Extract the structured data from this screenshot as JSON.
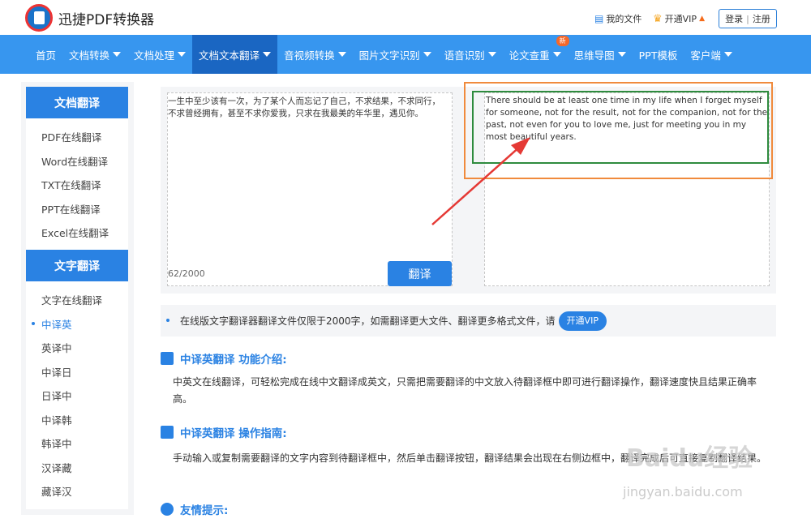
{
  "header": {
    "brand": "迅捷PDF转换器",
    "my_files": "我的文件",
    "vip": "开通VIP",
    "login": "登录",
    "separator": "|",
    "register": "注册"
  },
  "nav": {
    "items": [
      {
        "label": "首页",
        "dropdown": false
      },
      {
        "label": "文档转换",
        "dropdown": true
      },
      {
        "label": "文档处理",
        "dropdown": true
      },
      {
        "label": "文档文本翻译",
        "dropdown": true,
        "active": true
      },
      {
        "label": "音视频转换",
        "dropdown": true
      },
      {
        "label": "图片文字识别",
        "dropdown": true
      },
      {
        "label": "语音识别",
        "dropdown": true
      },
      {
        "label": "论文查重",
        "dropdown": true,
        "badge": "新"
      },
      {
        "label": "思维导图",
        "dropdown": true
      },
      {
        "label": "PPT模板",
        "dropdown": false
      },
      {
        "label": "客户端",
        "dropdown": true
      }
    ]
  },
  "sidebar": {
    "group1_title": "文档翻译",
    "group1_items": [
      "PDF在线翻译",
      "Word在线翻译",
      "TXT在线翻译",
      "PPT在线翻译",
      "Excel在线翻译"
    ],
    "group2_title": "文字翻译",
    "group2_items": [
      "文字在线翻译",
      "中译英",
      "英译中",
      "中译日",
      "日译中",
      "中译韩",
      "韩译中",
      "汉译藏",
      "藏译汉"
    ],
    "active_item": "中译英"
  },
  "translator": {
    "input_text": "一生中至少该有一次，为了某个人而忘记了自己，不求结果，不求同行，不求曾经拥有，甚至不求你爱我，只求在我最美的年华里，遇见你。",
    "counter": "62/2000",
    "translate_button": "翻译",
    "output_text": "There should be at least one time in my life when I forget myself for someone, not for the result, not for the companion, not for the past, not even for you to love me, just for meeting you in my most beautiful years."
  },
  "notice": {
    "text": "在线版文字翻译器翻译文件仅限于2000字，如需翻译更大文件、翻译更多格式文件，请",
    "button": "开通VIP"
  },
  "sections": {
    "intro_title": "中译英翻译 功能介绍:",
    "intro_body": "中英文在线翻译，可轻松完成在线中文翻译成英文，只需把需要翻译的中文放入待翻译框中即可进行翻译操作，翻译速度快且结果正确率高。",
    "guide_title": "中译英翻译 操作指南:",
    "guide_body": "手动输入或复制需要翻译的文字内容到待翻译框中，然后单击翻译按钮，翻译结果会出现在右侧边框中，翻译完成后可直接复制翻译结果。",
    "tips_title": "友情提示:"
  },
  "watermark": {
    "brand": "Baidu经验",
    "url": "jingyan.baidu.com"
  },
  "colors": {
    "nav_bg": "#3796ef",
    "nav_active": "#1a66c2",
    "accent": "#2a82e3",
    "annotation_orange": "#f08a3c",
    "annotation_green": "#2e8b3e",
    "arrow": "#e53935"
  }
}
